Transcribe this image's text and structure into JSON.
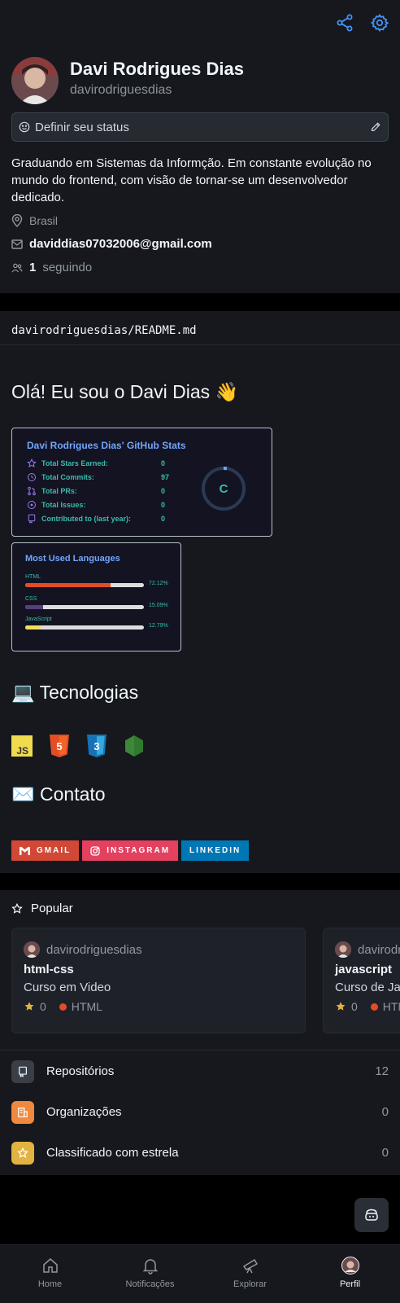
{
  "topbar": {
    "share_icon": "share-icon",
    "settings_icon": "gear-icon"
  },
  "profile": {
    "full_name": "Davi Rodrigues Dias",
    "login": "davirodriguesdias",
    "status_placeholder": "Definir seu status",
    "bio": "Graduando em Sistemas da Informção. Em constante evolução no mundo do frontend, com visão de tornar-se um desenvolvedor dedicado.",
    "location": "Brasil",
    "email": "daviddias07032006@gmail.com",
    "following_count": "1",
    "following_label": "seguindo"
  },
  "readme": {
    "path_owner": "davirodriguesdias/",
    "path_file": "README.md",
    "greeting": "Olá! Eu sou o Davi Dias 👋",
    "stats_card": {
      "title": "Davi Rodrigues Dias' GitHub Stats",
      "rows": [
        {
          "label": "Total Stars Earned:",
          "value": "0"
        },
        {
          "label": "Total Commits:",
          "value": "97"
        },
        {
          "label": "Total PRs:",
          "value": "0"
        },
        {
          "label": "Total Issues:",
          "value": "0"
        },
        {
          "label": "Contributed to (last year):",
          "value": "0"
        }
      ],
      "grade": "C",
      "accent": "#38bdae",
      "title_color": "#70a5fd"
    },
    "lang_card": {
      "title": "Most Used Languages",
      "languages": [
        {
          "name": "HTML",
          "percent_label": "72.12%",
          "percent": 72.12,
          "color": "#e34c26"
        },
        {
          "name": "CSS",
          "percent_label": "15.09%",
          "percent": 15.09,
          "color": "#563d7c"
        },
        {
          "name": "JavaScript",
          "percent_label": "12.79%",
          "percent": 12.79,
          "color": "#f1e05a"
        }
      ]
    },
    "tech_heading": "💻 Tecnologias",
    "tech_icons": [
      "javascript-icon",
      "html5-icon",
      "css3-icon",
      "nodejs-icon"
    ],
    "contact_heading": "✉️ Contato",
    "badges": [
      {
        "label": "GMAIL",
        "color": "#d14836"
      },
      {
        "label": "INSTAGRAM",
        "color": "#e4405f"
      },
      {
        "label": "LINKEDIN",
        "color": "#0077b5"
      }
    ]
  },
  "popular": {
    "heading": "Popular",
    "repos": [
      {
        "owner": "davirodriguesdias",
        "name": "html-css",
        "description": "Curso em Video",
        "stars": "0",
        "language": "HTML"
      },
      {
        "owner": "davirodriguesdias",
        "name": "javascript",
        "description": "Curso de Ja",
        "stars": "0",
        "language": "HTML"
      }
    ]
  },
  "lists": [
    {
      "label": "Repositórios",
      "count": "12",
      "color": "#3a3f47"
    },
    {
      "label": "Organizações",
      "count": "0",
      "color": "#f0883e"
    },
    {
      "label": "Classificado com estrela",
      "count": "0",
      "color": "#e3b341"
    }
  ],
  "nav": {
    "home": "Home",
    "notifications": "Notificações",
    "explore": "Explorar",
    "profile": "Perfil"
  }
}
